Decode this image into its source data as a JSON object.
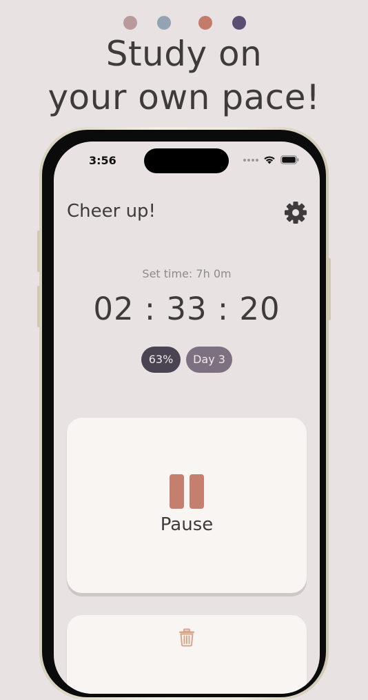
{
  "colors": {
    "background": "#e8e2e2",
    "text": "#3f3b3d",
    "accent_pause": "#c47f6e",
    "badge_percent": "#4a4452",
    "badge_day": "#7b7180",
    "trash": "#d9a58a"
  },
  "palette_dots": [
    "#b89a9b",
    "#93a3b1",
    "#c47b6a",
    "#5a4f72"
  ],
  "headline": {
    "line1": "Study on",
    "line2": "your own pace!"
  },
  "status_bar": {
    "time": "3:56",
    "icons": [
      "signal-dots-icon",
      "wifi-icon",
      "battery-icon"
    ]
  },
  "header": {
    "title": "Cheer up!",
    "settings_icon": "gear-icon"
  },
  "timer": {
    "set_time_label": "Set time: 7h 0m",
    "elapsed": "02 : 33 : 20"
  },
  "badges": {
    "percent": "63%",
    "day": "Day 3"
  },
  "pause_card": {
    "icon": "pause-icon",
    "label": "Pause"
  },
  "delete_card": {
    "icon": "trash-icon"
  }
}
